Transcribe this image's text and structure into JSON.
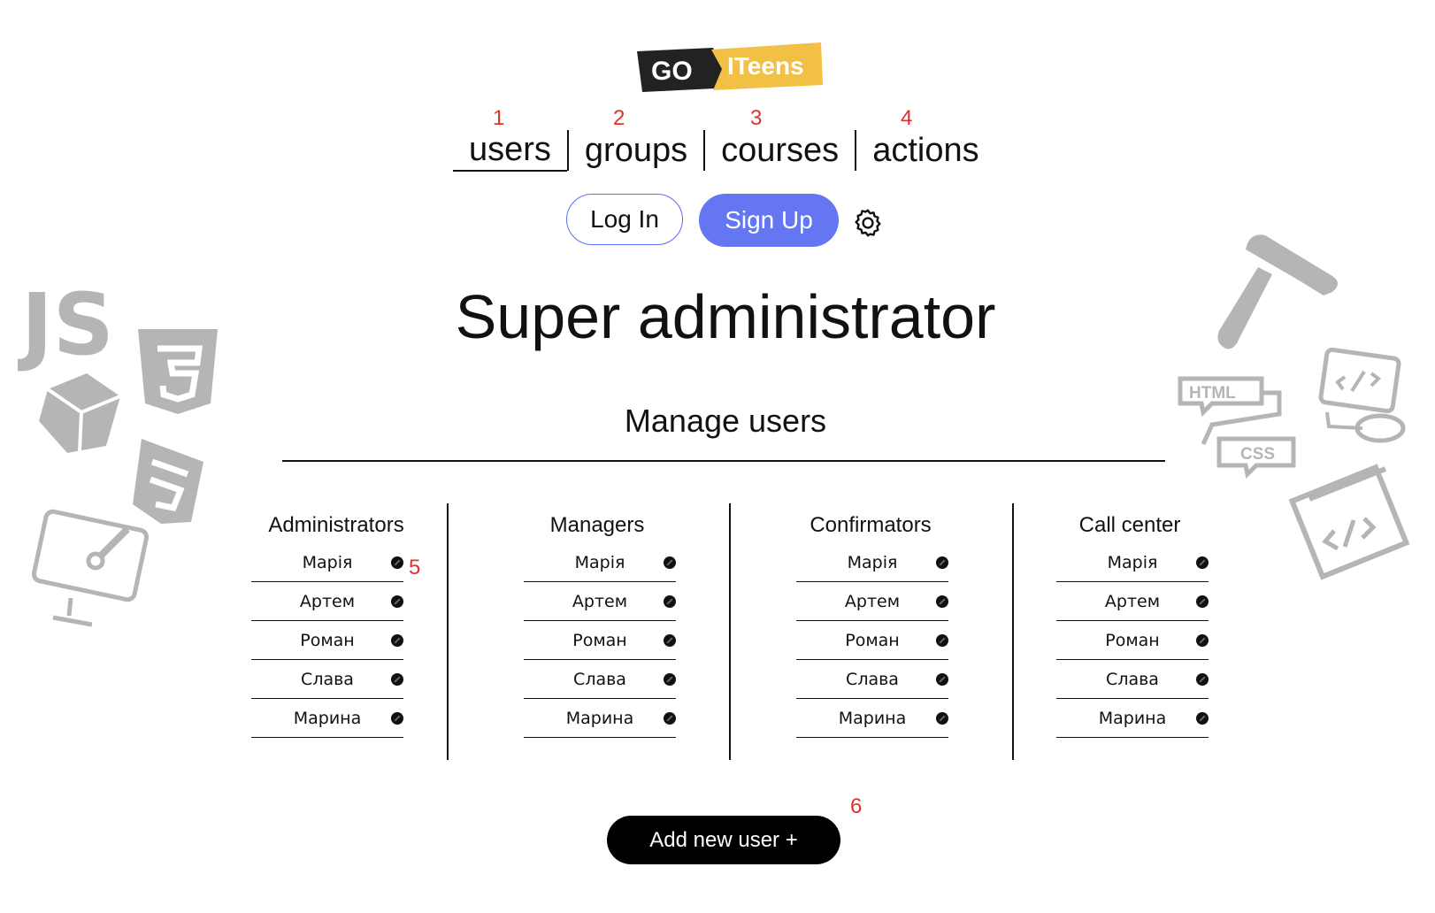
{
  "logo": {
    "part1": "GO",
    "part2": "ITeens"
  },
  "annotations": [
    "1",
    "2",
    "3",
    "4",
    "5",
    "6"
  ],
  "nav": {
    "items": [
      "users",
      "groups",
      "courses",
      "actions"
    ]
  },
  "auth": {
    "login": "Log In",
    "signup": "Sign Up"
  },
  "page_title": "Super administrator",
  "section_title": "Manage users",
  "columns": [
    {
      "title": "Administrators",
      "users": [
        "Марія",
        "Артем",
        "Роман",
        "Слава",
        "Марина"
      ]
    },
    {
      "title": "Managers",
      "users": [
        "Марія",
        "Артем",
        "Роман",
        "Слава",
        "Марина"
      ]
    },
    {
      "title": "Confirmators",
      "users": [
        "Марія",
        "Артем",
        "Роман",
        "Слава",
        "Марина"
      ]
    },
    {
      "title": "Call center",
      "users": [
        "Марія",
        "Артем",
        "Роман",
        "Слава",
        "Марина"
      ]
    }
  ],
  "add_button": "Add new user +",
  "decorations": {
    "js": "JS",
    "html_tag": "HTML",
    "css_tag": "CSS"
  },
  "colors": {
    "accent": "#6476f2",
    "annotation": "#e0302a",
    "logo_yellow": "#f2c045",
    "logo_dark": "#222222",
    "deco": "#b5b5b5"
  }
}
